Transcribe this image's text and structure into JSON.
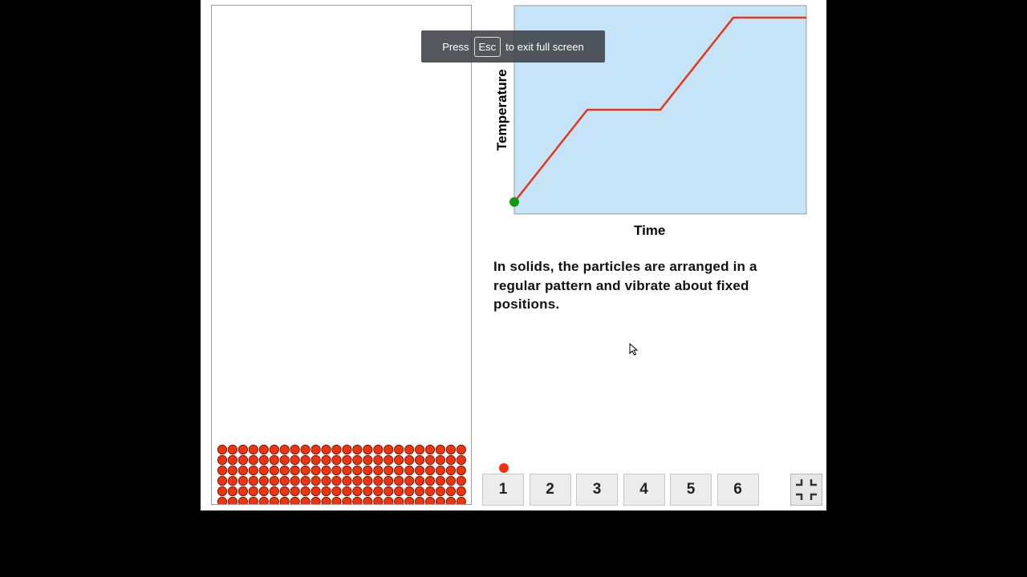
{
  "toast": {
    "before": "Press",
    "key": "Esc",
    "after": "to exit full screen"
  },
  "graph": {
    "ylabel": "Temperature",
    "xlabel": "Time",
    "colors": {
      "plot_bg": "#c5e4f8",
      "line": "#e8341c",
      "marker": "#119911"
    }
  },
  "chart_data": {
    "type": "line",
    "xlabel": "Time",
    "ylabel": "Temperature",
    "series": [
      {
        "points": [
          [
            0,
            0
          ],
          [
            1,
            1
          ],
          [
            2,
            1
          ],
          [
            3,
            2
          ],
          [
            4,
            2
          ]
        ]
      }
    ],
    "marker_point": [
      0,
      0
    ]
  },
  "description": "In solids, the particles are arranged in a regular pattern and vibrate about fixed positions.",
  "particles": {
    "state": "solid",
    "rows": 6,
    "columns": 24,
    "color": "#ee3310"
  },
  "steps": {
    "labels": [
      "1",
      "2",
      "3",
      "4",
      "5",
      "6"
    ],
    "current": 1
  },
  "icons": {
    "fullscreen": "exit-fullscreen-icon"
  }
}
